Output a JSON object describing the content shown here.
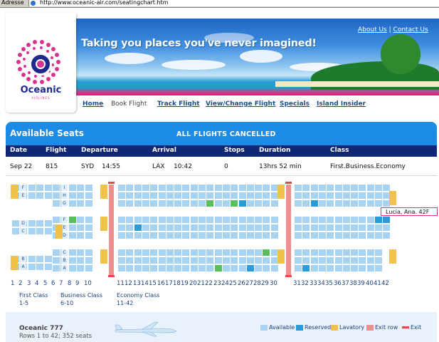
{
  "browser": {
    "address_label": "Adresse",
    "url": "http://www.oceanic-air.com/seatingchart.htm"
  },
  "brand": {
    "name": "Oceanic",
    "sub": "AIRLINES",
    "accent": "#d6338f",
    "navy": "#1d2a8c"
  },
  "header": {
    "tagline": "Taking you places you've never imagined!",
    "about": "About Us",
    "contact": "Contact Us",
    "sep": "|"
  },
  "nav": [
    "Home",
    "Book Flight",
    "Track Flight",
    "View/Change Flight",
    "Specials",
    "Island Insider"
  ],
  "nav_current": "Book Flight",
  "panel": {
    "title": "Available Seats",
    "notice": "ALL FLIGHTS CANCELLED"
  },
  "flight_info": {
    "headers": [
      "Date",
      "Flight",
      "Departure",
      "Arrival",
      "Stops",
      "Duration",
      "Class"
    ],
    "values": [
      "Sep 22",
      "815",
      "SYD",
      "14:55",
      "LAX",
      "10:42",
      "0",
      "13hrs 52 min",
      "First.Business.Economy"
    ]
  },
  "seat_letters_first": [
    "F",
    "E",
    "D",
    "C",
    "B",
    "A"
  ],
  "seat_letters_business": [
    "I",
    "H",
    "G",
    "F",
    "E",
    "D",
    "C",
    "B",
    "A"
  ],
  "row_numbers": [
    "1",
    "2",
    "3",
    "4",
    "5",
    "6",
    "7",
    "8",
    "9",
    "10",
    "11",
    "12",
    "13",
    "14",
    "15",
    "16",
    "17",
    "18",
    "19",
    "20",
    "21",
    "22",
    "23",
    "24",
    "25",
    "26",
    "27",
    "28",
    "29",
    "30",
    "31",
    "32",
    "33",
    "34",
    "35",
    "36",
    "37",
    "38",
    "39",
    "40",
    "41",
    "42"
  ],
  "tooltip": "Lucia, Ana. 42F",
  "classes": [
    {
      "name": "First Class",
      "rows": "1-5"
    },
    {
      "name": "Business Class",
      "rows": "6-10"
    },
    {
      "name": "Economy Class",
      "rows": "11-42"
    }
  ],
  "aircraft": {
    "model": "Oceanic 777",
    "rows": "Rows 1 to 42; 352 seats"
  },
  "legend": [
    {
      "label": "Available",
      "color": "#a7d2f2"
    },
    {
      "label": "Reserved",
      "color": "#2a9ad8"
    },
    {
      "label": "Lavatory",
      "color": "#f1c24a"
    },
    {
      "label": "Exit row",
      "color": "#f28d8d"
    },
    {
      "label": "Exit",
      "color": "#e5484d"
    }
  ]
}
